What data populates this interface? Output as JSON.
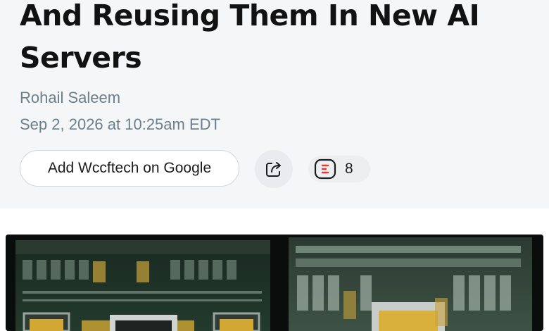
{
  "article": {
    "title_line1": "And Reusing Them In New AI",
    "title_line2": "Servers",
    "author": "Rohail Saleem",
    "date": "Sep 2, 2026 at 10:25am EDT"
  },
  "actions": {
    "add_source_label": "Add Wccftech on Google",
    "share_icon": "share-icon",
    "comment_icon": "comment-icon",
    "comment_count": "8"
  },
  "colors": {
    "header_bg": "#f5f6f8",
    "meta_text": "#6c7f8a",
    "comment_accent": "#e53935"
  }
}
